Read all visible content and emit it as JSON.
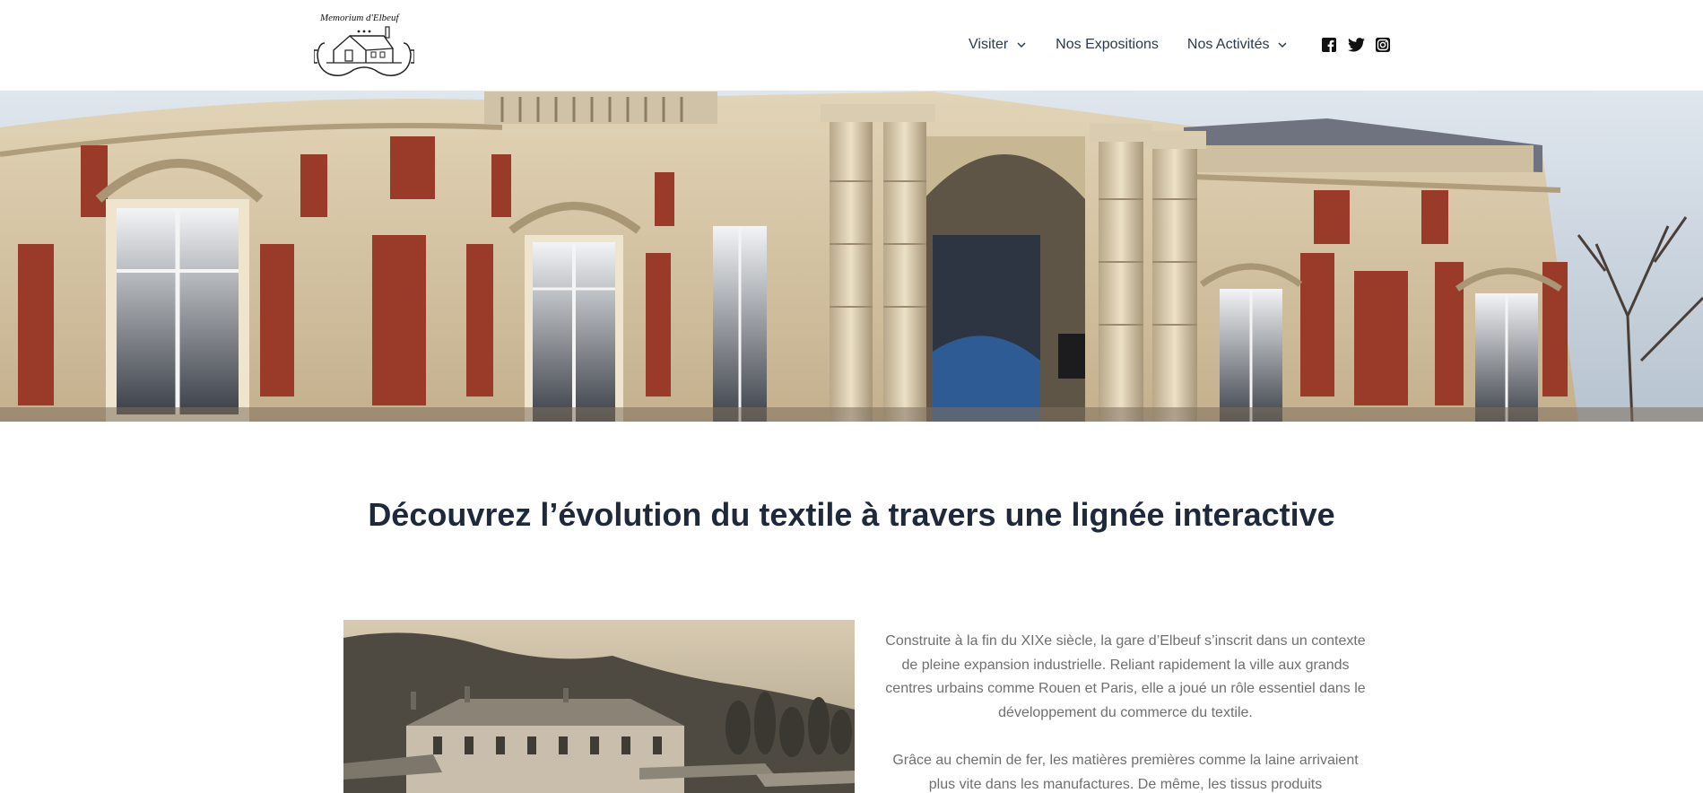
{
  "logo": {
    "text": "Memorium d'Elbeuf",
    "icon": "museum-vr-headset-logo"
  },
  "nav": {
    "items": [
      {
        "label": "Visiter",
        "has_dropdown": true
      },
      {
        "label": "Nos Expositions",
        "has_dropdown": false
      },
      {
        "label": "Nos Activités",
        "has_dropdown": true
      }
    ],
    "social": [
      "facebook-icon",
      "twitter-icon",
      "instagram-icon"
    ]
  },
  "hero": {
    "image": "facade-of-ornate-stone-and-brick-building-with-columns"
  },
  "main": {
    "headline": "Découvrez l’évolution du textile à travers une lignée interactive",
    "paragraph1": "Construite à la fin du XIXe siècle, la gare d’Elbeuf s’inscrit dans un contexte de pleine expansion industrielle. Reliant rapidement la ville aux grands centres urbains comme Rouen et Paris, elle a joué un rôle essentiel dans le développement du commerce du textile.",
    "paragraph2": "Grâce au chemin de fer, les matières premières comme la laine arrivaient plus vite dans les manufactures. De même, les tissus produits",
    "photo": "vintage-postcard-elbeuf-train-station"
  },
  "colors": {
    "heading": "#1e2a3b",
    "nav_text": "#2b3a4d",
    "body_text": "#6f6f6f",
    "brick": "#9a3b2a",
    "stone": "#d8c8a8"
  }
}
